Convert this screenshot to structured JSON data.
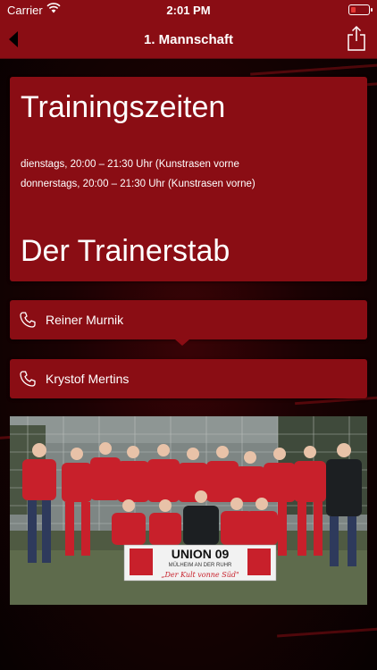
{
  "status_bar": {
    "carrier": "Carrier",
    "time": "2:01 PM",
    "battery_level": 0.2
  },
  "nav": {
    "title": "1. Mannschaft",
    "back_icon": "chevron-left-icon",
    "share_icon": "share-icon"
  },
  "training": {
    "heading": "Trainingszeiten",
    "times": [
      "dienstags, 20:00 – 21:30 Uhr (Kunstrasen vorne",
      "donnerstags, 20:00 – 21:30 Uhr (Kunstrasen vorne)"
    ]
  },
  "staff": {
    "heading": "Der Trainerstab",
    "trainers": [
      {
        "name": "Reiner Murnik",
        "icon": "phone-icon"
      },
      {
        "name": "Krystof Mertins",
        "icon": "phone-icon"
      }
    ]
  },
  "photo": {
    "banner_title": "UNION 09",
    "banner_subtitle": "MÜLHEIM AN DER RUHR",
    "banner_slogan": "„Der Kult vonne Süd\""
  },
  "colors": {
    "primary": "#8a0d14",
    "background": "#0d0203"
  }
}
